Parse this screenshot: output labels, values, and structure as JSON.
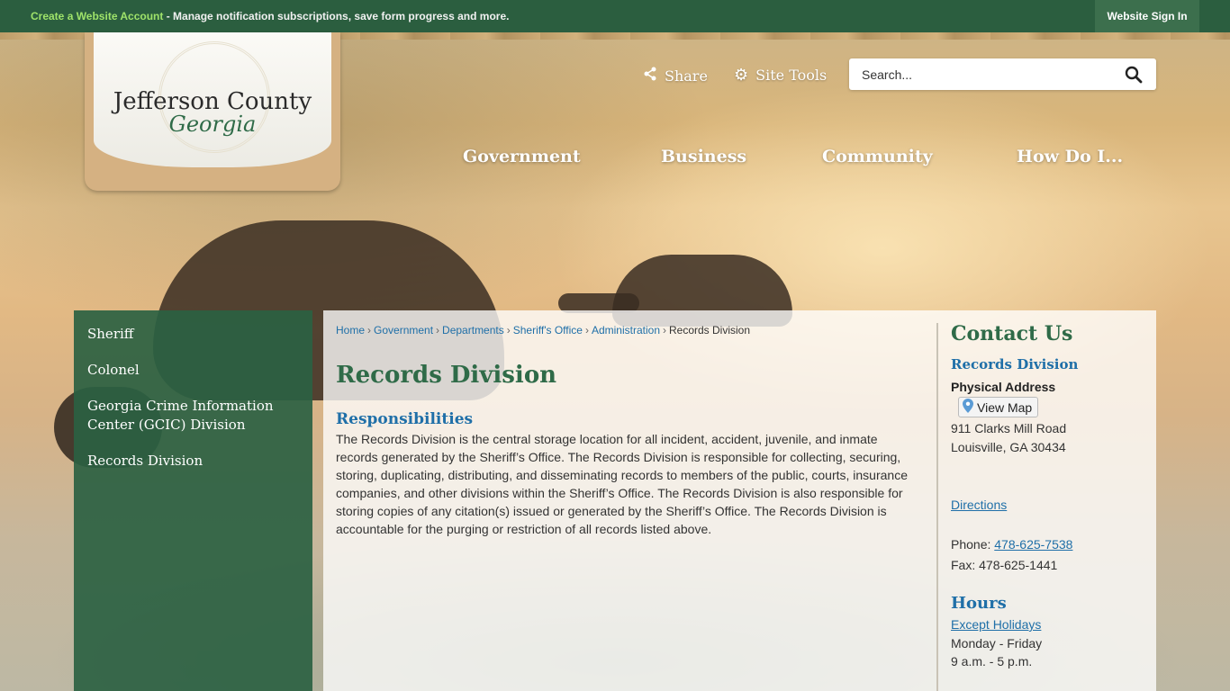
{
  "topbar": {
    "create_label": "Create a Website Account",
    "message": " - Manage notification subscriptions, save form progress and more.",
    "signin_label": "Website Sign In"
  },
  "logo": {
    "title": "Jefferson County",
    "subtitle": "Georgia"
  },
  "tools": {
    "share_label": "Share",
    "sitetools_label": "Site Tools"
  },
  "search": {
    "placeholder": "Search..."
  },
  "nav": {
    "items": [
      "Government",
      "Business",
      "Community",
      "How Do I..."
    ]
  },
  "sidebar": {
    "items": [
      {
        "label": "Sheriff"
      },
      {
        "label": "Colonel"
      },
      {
        "label": "Georgia Crime Information Center (GCIC) Division"
      },
      {
        "label": "Records Division"
      }
    ]
  },
  "breadcrumb": {
    "links": [
      "Home",
      "Government",
      "Departments",
      "Sheriff's Office",
      "Administration"
    ],
    "separator": "›",
    "current": "Records Division"
  },
  "main": {
    "title": "Records Division",
    "section_title": "Responsibilities",
    "body": "The Records Division is the central storage location for all incident, accident, juvenile, and inmate records generated by the Sheriff’s Office. The Records Division is responsible for collecting, securing, storing, duplicating, distributing, and disseminating records to members of the public, courts, insurance companies, and other divisions within the Sheriff’s Office. The Records Division is also responsible for storing copies of any citation(s) issued or generated by the Sheriff’s Office. The Records Division is accountable for the purging or restriction of all records listed above."
  },
  "contact": {
    "title": "Contact Us",
    "department": "Records Division",
    "address_label": "Physical Address",
    "view_map_label": "View Map",
    "address_line1": "911 Clarks Mill Road",
    "address_line2": "Louisville, GA 30434",
    "directions_label": "Directions",
    "phone_label": "Phone: ",
    "phone": "478-625-7538",
    "fax": "Fax: 478-625-1441",
    "hours_title": "Hours",
    "holidays_label": "Except Holidays",
    "days": "Monday - Friday",
    "hours": "9 a.m. - 5 p.m."
  },
  "colors": {
    "brand_green": "#2b5e3f",
    "link_blue": "#1f6fa8",
    "title_green": "#2f6b48"
  }
}
